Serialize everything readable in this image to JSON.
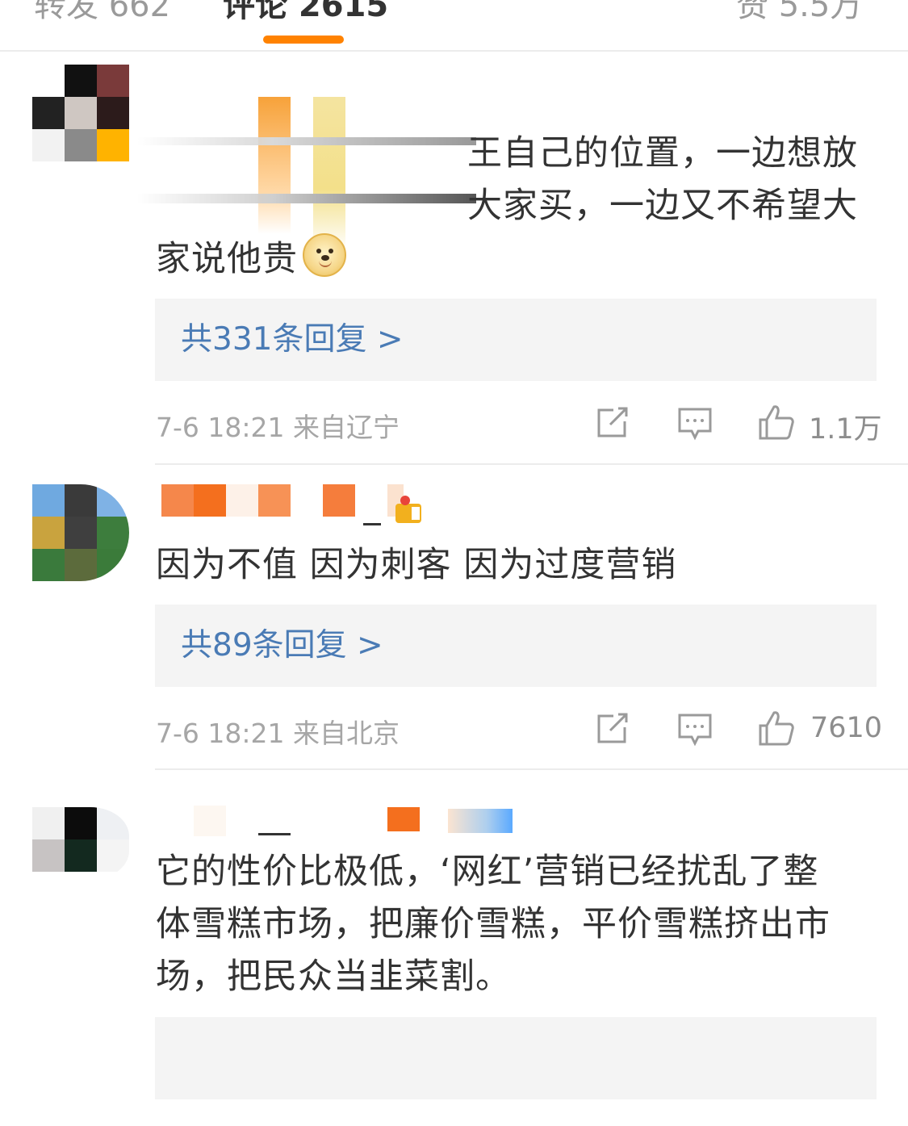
{
  "tabs": [
    {
      "label": "转发 662",
      "active": false
    },
    {
      "label": "评论 2615",
      "active": true
    },
    {
      "label": "赞 5.5万",
      "active": false
    }
  ],
  "accent_color": "#ff8200",
  "link_color": "#4a7bb5",
  "comments": [
    {
      "text_line1": "王自己的位置，一边想放",
      "text_line2": "大家买，一边又不希望大",
      "text_line3": "家说他贵",
      "emoji": "doge-emoji",
      "replies_label": "共331条回复 >",
      "timestamp": "7-6 18:21",
      "location": "来自辽宁",
      "likes": "1.1万"
    },
    {
      "text": "因为不值 因为刺客 因为过度营销",
      "replies_label": "共89条回复 >",
      "timestamp": "7-6 18:21",
      "location": "来自北京",
      "likes": "7610"
    },
    {
      "text_line1": "它的性价比极低，‘网红’营销已经扰乱了整",
      "text_line2": "体雪糕市场，把廉价雪糕，平价雪糕挤出市",
      "text_line3": "场，把民众当韭菜割。"
    }
  ],
  "icons": [
    "share-icon",
    "comment-icon",
    "like-icon",
    "doge-emoji"
  ]
}
